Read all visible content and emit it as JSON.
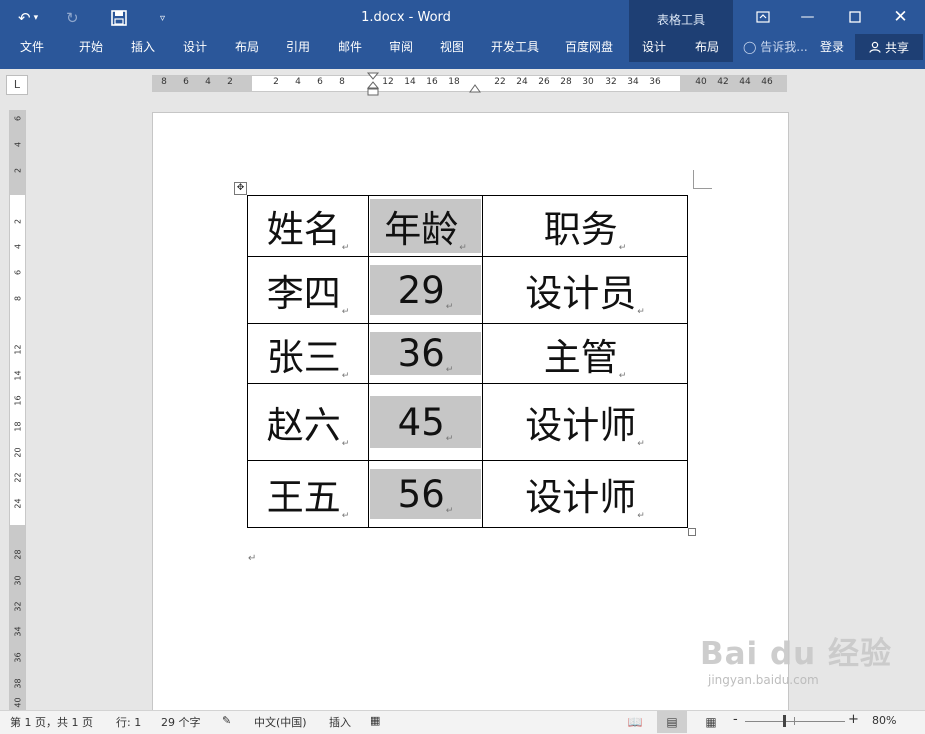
{
  "app": {
    "doc_title": "1.docx - Word",
    "context_title": "表格工具",
    "tabs": [
      "文件",
      "开始",
      "插入",
      "设计",
      "布局",
      "引用",
      "邮件",
      "审阅",
      "视图",
      "开发工具",
      "百度网盘",
      "设计",
      "布局"
    ],
    "tell_me": "告诉我...",
    "login": "登录",
    "share": "共享"
  },
  "icons": {
    "undo": "undo-icon",
    "redo": "redo-icon",
    "save": "save-icon",
    "customize": "customize-qat-icon",
    "ribbon_display": "ribbon-display-icon",
    "minimize": "minimize-icon",
    "maximize": "maximize-icon",
    "close": "close-icon",
    "lightbulb": "lightbulb-icon",
    "person": "person-icon"
  },
  "ruler": {
    "tab_selector": "L",
    "horizontal": [
      "8",
      "6",
      "4",
      "2",
      "2",
      "4",
      "6",
      "8",
      "12",
      "14",
      "16",
      "18",
      "22",
      "24",
      "26",
      "28",
      "30",
      "32",
      "34",
      "36",
      "40",
      "42",
      "44",
      "46"
    ],
    "vertical": [
      "6",
      "4",
      "2",
      "2",
      "4",
      "6",
      "8",
      "12",
      "14",
      "16",
      "18",
      "20",
      "22",
      "24",
      "28",
      "30",
      "32",
      "34",
      "36",
      "38",
      "40"
    ]
  },
  "table": {
    "rows": [
      [
        "姓名",
        "年龄",
        "职务"
      ],
      [
        "李四",
        "29",
        "设计员"
      ],
      [
        "张三",
        "36",
        "主管"
      ],
      [
        "赵六",
        "45",
        "设计师"
      ],
      [
        "王五",
        "56",
        "设计师"
      ]
    ],
    "shaded_column": 1,
    "shade_color": "#c6c6c6",
    "mark": "↵"
  },
  "watermark": {
    "logo": "Bai du 经验",
    "url": "jingyan.baidu.com"
  },
  "status": {
    "page": "第 1 页，共 1 页",
    "line": "行: 1",
    "words": "29 个字",
    "language": "中文(中国)",
    "mode": "插入",
    "zoom": "80%",
    "minus": "-",
    "plus": "+"
  },
  "colors": {
    "ribbon": "#2b579a",
    "context": "#1e3f74"
  }
}
